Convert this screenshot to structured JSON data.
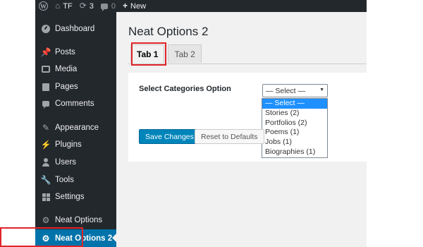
{
  "admin_bar": {
    "site_name": "TF",
    "updates_count": "3",
    "comments_count": "0",
    "new_label": "New"
  },
  "sidebar": {
    "items": [
      {
        "label": "Dashboard",
        "icon": "dashboard-icon"
      },
      {
        "label": "Posts",
        "icon": "pin-icon"
      },
      {
        "label": "Media",
        "icon": "media-icon"
      },
      {
        "label": "Pages",
        "icon": "page-icon"
      },
      {
        "label": "Comments",
        "icon": "comment-icon"
      },
      {
        "label": "Appearance",
        "icon": "brush-icon"
      },
      {
        "label": "Plugins",
        "icon": "plug-icon"
      },
      {
        "label": "Users",
        "icon": "user-icon"
      },
      {
        "label": "Tools",
        "icon": "wrench-icon"
      },
      {
        "label": "Settings",
        "icon": "settings-icon"
      },
      {
        "label": "Neat Options",
        "icon": "gear-icon"
      },
      {
        "label": "Neat Options 2",
        "icon": "gear-icon",
        "current": true
      }
    ]
  },
  "page": {
    "title": "Neat Options 2",
    "tabs": [
      {
        "label": "Tab 1",
        "active": true
      },
      {
        "label": "Tab 2",
        "active": false
      }
    ],
    "field_label": "Select Categories Option",
    "select": {
      "value": "— Select —",
      "options": [
        "— Select —",
        "Stories (2)",
        "Portfolios (2)",
        "Poems (1)",
        "Jobs (1)",
        "Biographies (1)"
      ]
    },
    "save_label": "Save Changes",
    "reset_label": "Reset to Defaults"
  },
  "colors": {
    "admin_dark": "#23282d",
    "accent": "#0073aa",
    "highlight_outline": "#e0242a",
    "option_selected": "#1e90ff"
  }
}
